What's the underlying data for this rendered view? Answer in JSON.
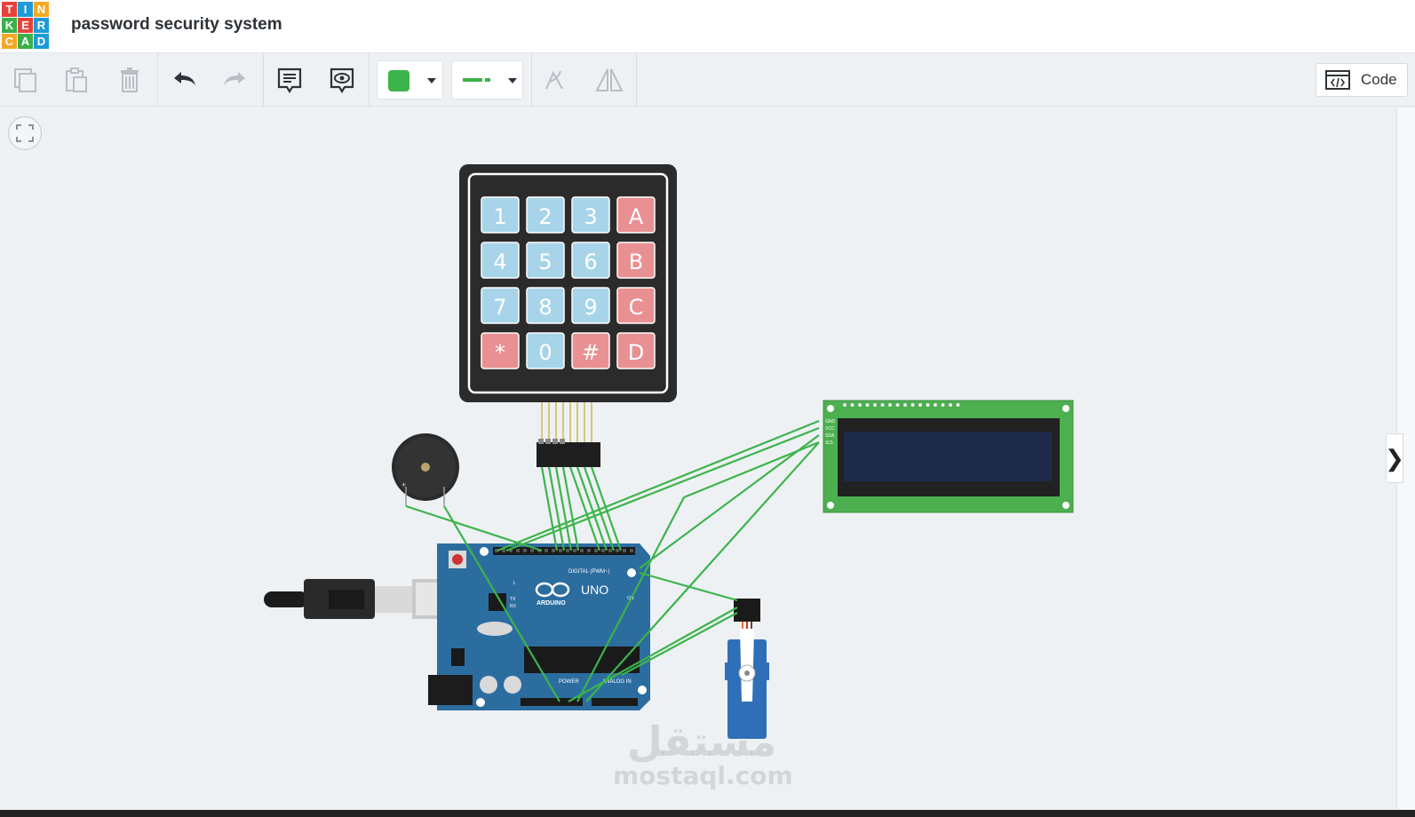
{
  "app": {
    "logo_letters": [
      "T",
      "I",
      "N",
      "K",
      "E",
      "R",
      "C",
      "A",
      "D"
    ],
    "logo_colors": [
      "#e8423b",
      "#1e9bd7",
      "#f7a823",
      "#3bb04a",
      "#e8423b",
      "#1e9bd7",
      "#f7a823",
      "#3bb04a",
      "#1e9bd7"
    ],
    "title": "password security system"
  },
  "toolbar": {
    "buttons": [
      "copy-icon",
      "paste-icon",
      "delete-icon",
      "undo-icon",
      "redo-icon",
      "notes-icon",
      "view-notes-icon",
      "color-dropdown",
      "line-style-dropdown",
      "rotate-icon",
      "flip-icon"
    ],
    "wire_color": "#3cb44b",
    "code_label": "Code"
  },
  "keypad": {
    "keys": [
      [
        "1",
        "2",
        "3",
        "A"
      ],
      [
        "4",
        "5",
        "6",
        "B"
      ],
      [
        "7",
        "8",
        "9",
        "C"
      ],
      [
        "*",
        "0",
        "#",
        "D"
      ]
    ],
    "blue_key": "#a8d4ea",
    "red_key": "#e99092"
  },
  "lcd": {
    "pins": [
      "GND",
      "VCC",
      "SDA",
      "SCL"
    ]
  },
  "arduino": {
    "brand": "ARDUINO",
    "model": "UNO",
    "labels": {
      "digital": "DIGITAL (PWM~)",
      "power": "POWER",
      "analog": "ANALOG IN",
      "on": "ON",
      "l": "L",
      "tx": "TX",
      "rx": "RX"
    }
  },
  "watermark": {
    "arabic": "مستقل",
    "latin": "mostaql.com"
  }
}
